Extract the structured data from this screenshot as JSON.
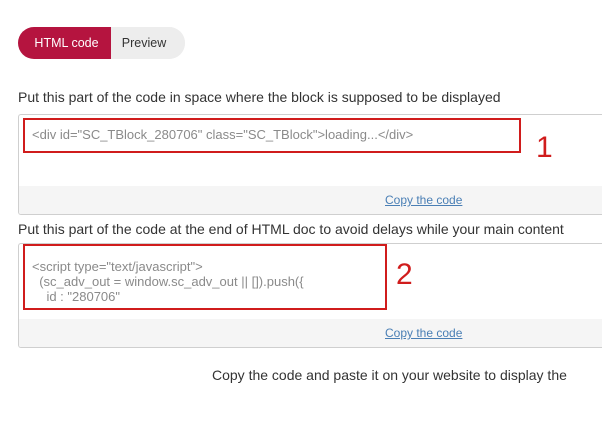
{
  "tabs": {
    "html_code": "HTML code",
    "preview": "Preview"
  },
  "section1": {
    "instruction": "Put this part of the code in space where the block is supposed to be displayed",
    "code": "<div id=\"SC_TBlock_280706\" class=\"SC_TBlock\">loading...</div>",
    "copy_label": "Copy the code",
    "marker": "1"
  },
  "section2": {
    "instruction": "Put this part of the code at the end of HTML doc to avoid delays while your main content",
    "code_lines": [
      "<script type=\"text/javascript\">",
      "  (sc_adv_out = window.sc_adv_out || []).push({",
      "    id : \"280706\""
    ],
    "copy_label": "Copy the code",
    "marker": "2"
  },
  "footer_text": "Copy the code and paste it on your website to display the",
  "colors": {
    "accent": "#b5143f",
    "annotation_red": "#d01c1c",
    "link": "#4a7fb5"
  }
}
